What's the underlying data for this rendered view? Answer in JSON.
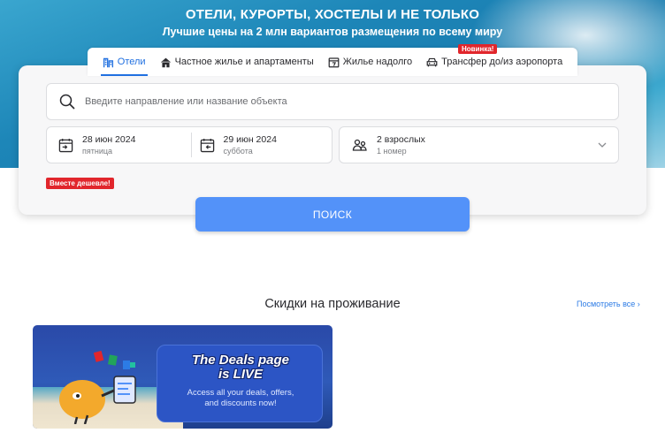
{
  "hero": {
    "title": "ОТЕЛИ, КУРОРТЫ, ХОСТЕЛЫ И НЕ ТОЛЬКО",
    "subtitle": "Лучшие цены на 2 млн вариантов размещения по всему миру"
  },
  "tabs": [
    {
      "label": "Отели",
      "icon": "hotel-icon",
      "active": true
    },
    {
      "label": "Частное жилье и апартаменты",
      "icon": "house-icon",
      "active": false
    },
    {
      "label": "Жилье надолго",
      "icon": "calendar-7-icon",
      "active": false
    },
    {
      "label": "Трансфер до/из аэропорта",
      "icon": "car-icon",
      "active": false
    }
  ],
  "badge_new": "Новинка!",
  "search": {
    "placeholder": "Введите направление или название объекта"
  },
  "checkin": {
    "date": "28 июн 2024",
    "weekday": "пятница"
  },
  "checkout": {
    "date": "29 июн 2024",
    "weekday": "суббота"
  },
  "guests": {
    "main": "2 взрослых",
    "sub": "1 номер"
  },
  "cheaper_badge": "Вместе дешевле!",
  "search_button": "ПОИСК",
  "deals": {
    "title": "Скидки на проживание",
    "see_all": "Посмотреть все ›",
    "promo_heading_1": "The Deals page",
    "promo_heading_2": "is LIVE",
    "promo_text_1": "Access all your deals, offers,",
    "promo_text_2": "and discounts now!"
  },
  "colors": {
    "accent": "#5392f9",
    "active_tab": "#1f6fe0",
    "badge_red": "#e1262c",
    "link": "#2c7be5"
  }
}
